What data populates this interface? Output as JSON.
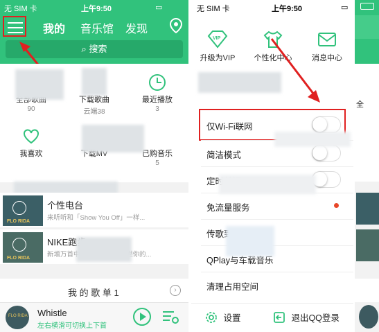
{
  "status": {
    "carrier": "无 SIM 卡",
    "time": "上午9:50"
  },
  "left": {
    "tabs": [
      "我的",
      "音乐馆",
      "发现"
    ],
    "search_label": "搜索",
    "grid": [
      {
        "label": "全部歌曲",
        "sub": "90"
      },
      {
        "label": "下载歌曲",
        "sub": "云端38"
      },
      {
        "label": "最近播放",
        "sub": "3"
      },
      {
        "label": "我喜欢",
        "sub": ""
      },
      {
        "label": "下载MV",
        "sub": ""
      },
      {
        "label": "已购音乐",
        "sub": "5"
      }
    ],
    "rows": [
      {
        "title": "个性电台",
        "subtitle": "来听听和「Show You Off」一样...",
        "cover": "FLO RIDA"
      },
      {
        "title": "NIKE跑步",
        "subtitle": "新增万首中文跑步歌曲，点燃你的...",
        "cover": "FLO RIDA"
      }
    ],
    "playlist_header": "我 的 歌 单  1",
    "player": {
      "title": "Whistle",
      "subtitle": "左右横滑可切换上下首",
      "cover": "FLO RIDA"
    },
    "colors": {
      "green": "#31c27c",
      "accent_red": "#e02020"
    }
  },
  "mid": {
    "top_items": [
      {
        "label": "升级为VIP",
        "icon": "vip-diamond-icon"
      },
      {
        "label": "个性化中心",
        "icon": "tshirt-icon"
      },
      {
        "label": "消息中心",
        "icon": "mail-icon"
      }
    ],
    "settings": [
      {
        "label": "仅Wi-Fi联网",
        "control": "toggle",
        "on": false
      },
      {
        "label": "简洁模式",
        "control": "toggle",
        "on": false
      },
      {
        "label": "定时关闭",
        "control": "toggle",
        "on": false
      },
      {
        "label": "免流量服务",
        "control": "dot"
      },
      {
        "label": "传歌到手机",
        "control": "none"
      },
      {
        "label": "QPlay与车载音乐",
        "control": "none"
      },
      {
        "label": "清理占用空间",
        "control": "none"
      }
    ],
    "footer": {
      "settings_label": "设置",
      "logout_label": "退出QQ登录"
    }
  },
  "right": {
    "partial_label": "全"
  }
}
